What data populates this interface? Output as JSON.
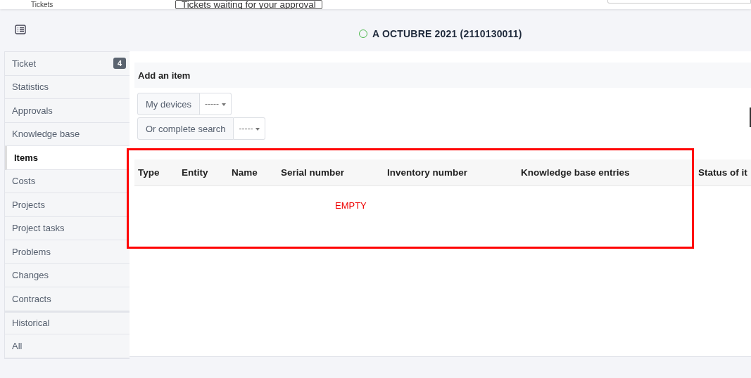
{
  "top_bar": {
    "breadcrumb": "Tickets",
    "approval_button": "Tickets waiting for your approval"
  },
  "header": {
    "title": "A OCTUBRE 2021 (2110130011)"
  },
  "tabs": [
    {
      "label": "Ticket",
      "badge": "4",
      "selected": false
    },
    {
      "label": "Statistics",
      "selected": false
    },
    {
      "label": "Approvals",
      "selected": false
    },
    {
      "label": "Knowledge base",
      "selected": false
    },
    {
      "label": "Items",
      "selected": true
    },
    {
      "label": "Costs",
      "selected": false
    },
    {
      "label": "Projects",
      "selected": false
    },
    {
      "label": "Project tasks",
      "selected": false
    },
    {
      "label": "Problems",
      "selected": false
    },
    {
      "label": "Changes",
      "selected": false
    },
    {
      "label": "Contracts",
      "selected": false
    },
    {
      "label": "Historical",
      "selected": false,
      "group_start": true
    },
    {
      "label": "All",
      "selected": false
    }
  ],
  "add_item": {
    "title": "Add an item",
    "selectors": [
      {
        "label": "My devices",
        "value": "-----"
      },
      {
        "label": "Or complete search",
        "value": "-----"
      }
    ]
  },
  "table": {
    "columns": [
      "Type",
      "Entity",
      "Name",
      "Serial number",
      "Inventory number",
      "Knowledge base entries",
      "Status of it"
    ],
    "annotation": "EMPTY"
  }
}
